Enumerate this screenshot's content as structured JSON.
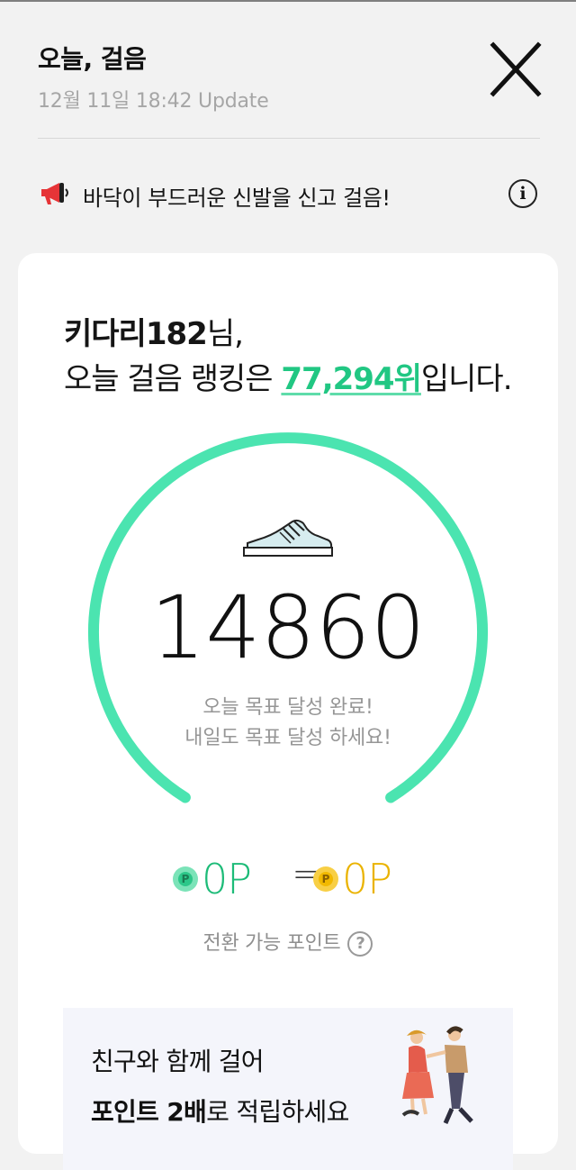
{
  "header": {
    "title": "오늘, 걸음",
    "update": "12월 11일 18:42 Update"
  },
  "notice": {
    "text": "바닥이 부드러운 신발을 신고 걸음!"
  },
  "card": {
    "greeting_name": "키다리182",
    "greeting_suffix": "님,",
    "rank_prefix": "오늘 걸음 랭킹은 ",
    "rank_value": "77,294위",
    "rank_suffix": "입니다.",
    "step_count": "14860",
    "goal_line1": "오늘 목표 달성 완료!",
    "goal_line2": "내일도 목표 달성 하세요!",
    "points_green": "0P",
    "points_equals": "=",
    "points_yellow": "0P",
    "convertible_label": "전환 가능 포인트"
  },
  "promo": {
    "line1": "친구와 함께 걸어",
    "line2_bold": "포인트 2배",
    "line2_rest": "로 적립하세요"
  },
  "icons": {
    "close": "close-icon",
    "notice": "megaphone-icon",
    "info": "info-icon",
    "shoe": "shoe-icon",
    "coin_green": "green-point-coin-icon",
    "coin_yellow": "yellow-point-coin-icon",
    "help": "question-icon",
    "promo_illustration": "walking-couple-illustration"
  },
  "colors": {
    "accent_green": "#21c783",
    "gauge_green": "#4be4b0",
    "accent_yellow": "#eab300",
    "background": "#f2f2f2"
  }
}
